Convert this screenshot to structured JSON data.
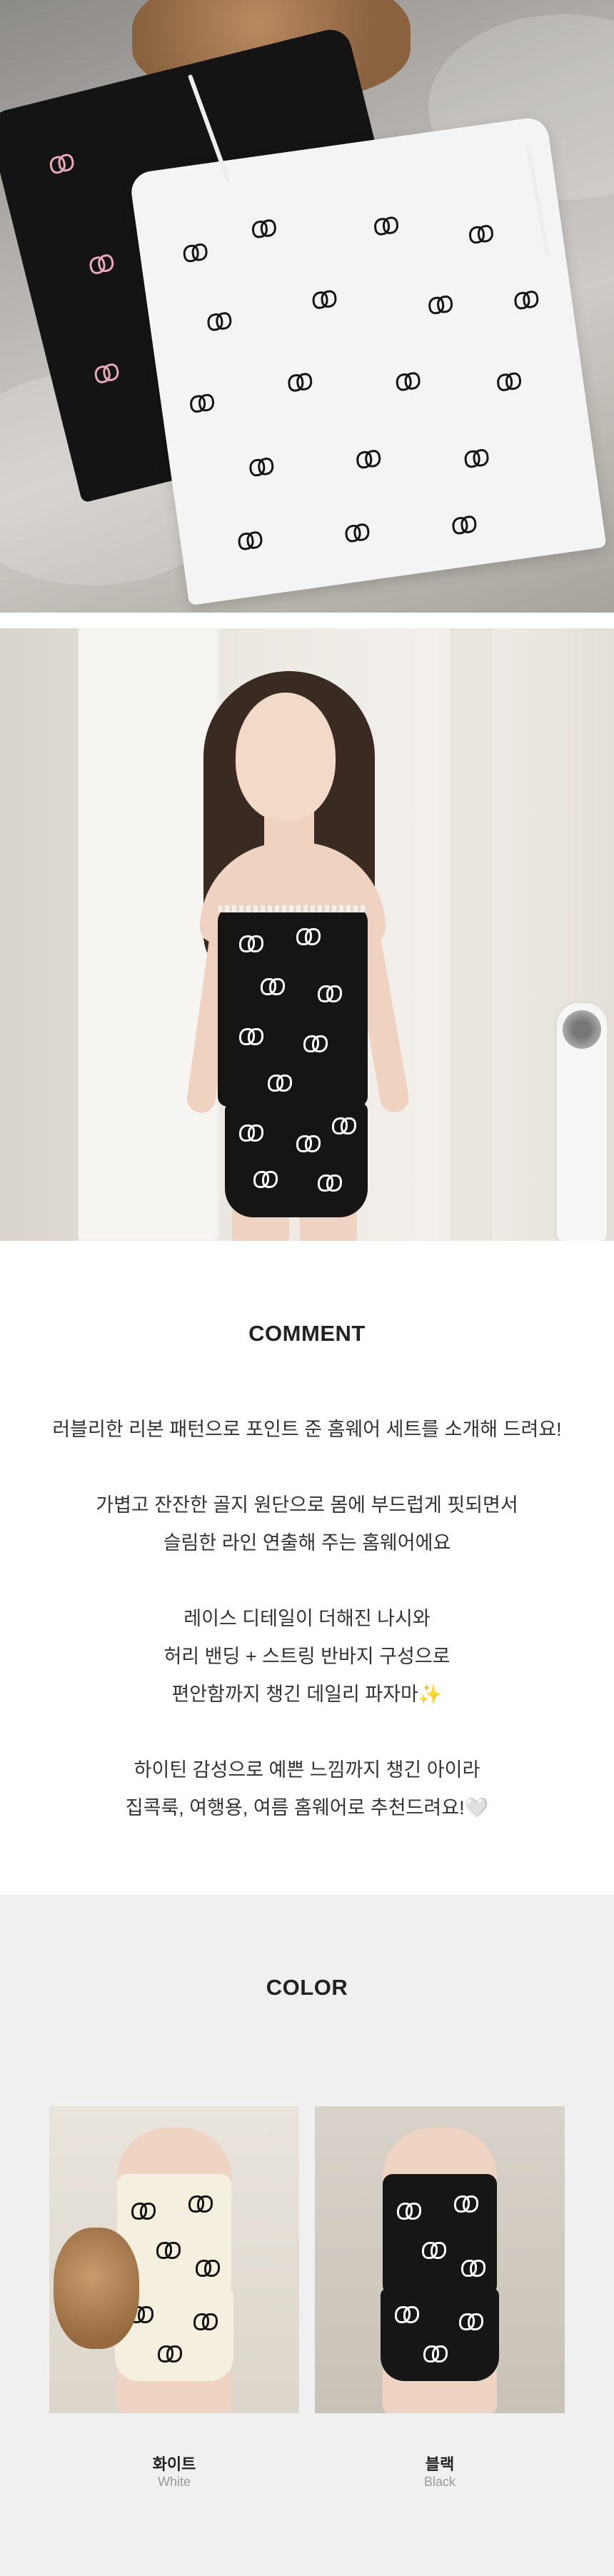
{
  "comment": {
    "title": "COMMENT",
    "lines": [
      "러블리한 리본 패턴으로 포인트 준 홈웨어 세트를 소개해 드려요!",
      "가볍고 잔잔한 골지 원단으로 몸에 부드럽게 핏되면서",
      "슬림한 라인 연출해 주는 홈웨어에요",
      "레이스 디테일이 더해진 나시와",
      "허리 밴딩 + 스트링 반바지 구성으로",
      "편안함까지 챙긴 데일리 파자마✨",
      "하이틴 감성으로 예쁜 느낌까지 챙긴 아이라",
      "집콕룩, 여행용, 여름 홈웨어로 추천드려요!🤍"
    ]
  },
  "color": {
    "title": "COLOR",
    "options": [
      {
        "name": "화이트",
        "sub": "White"
      },
      {
        "name": "블랙",
        "sub": "Black"
      }
    ]
  },
  "colors": {
    "background": "#ffffff",
    "color_section_bg": "#f0f0f0",
    "title_text": "#222222",
    "body_text": "#333333",
    "sub_text": "#999999"
  }
}
